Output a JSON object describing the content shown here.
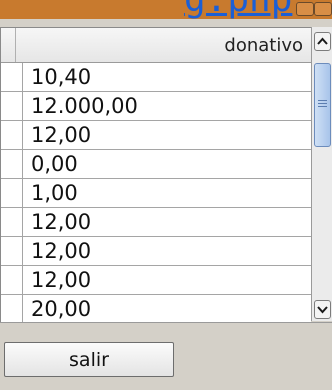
{
  "window": {
    "title_fragment": "g.php"
  },
  "table": {
    "column_header": "donativo",
    "rows": [
      "10,40",
      "12.000,00",
      "12,00",
      "0,00",
      "1,00",
      "12,00",
      "12,00",
      "12,00",
      "20,00"
    ]
  },
  "footer": {
    "exit_label": "salir"
  },
  "colors": {
    "titlebar": "#c87a2e",
    "link": "#1b5fd6",
    "scroll_thumb": "#a8c4ea"
  }
}
